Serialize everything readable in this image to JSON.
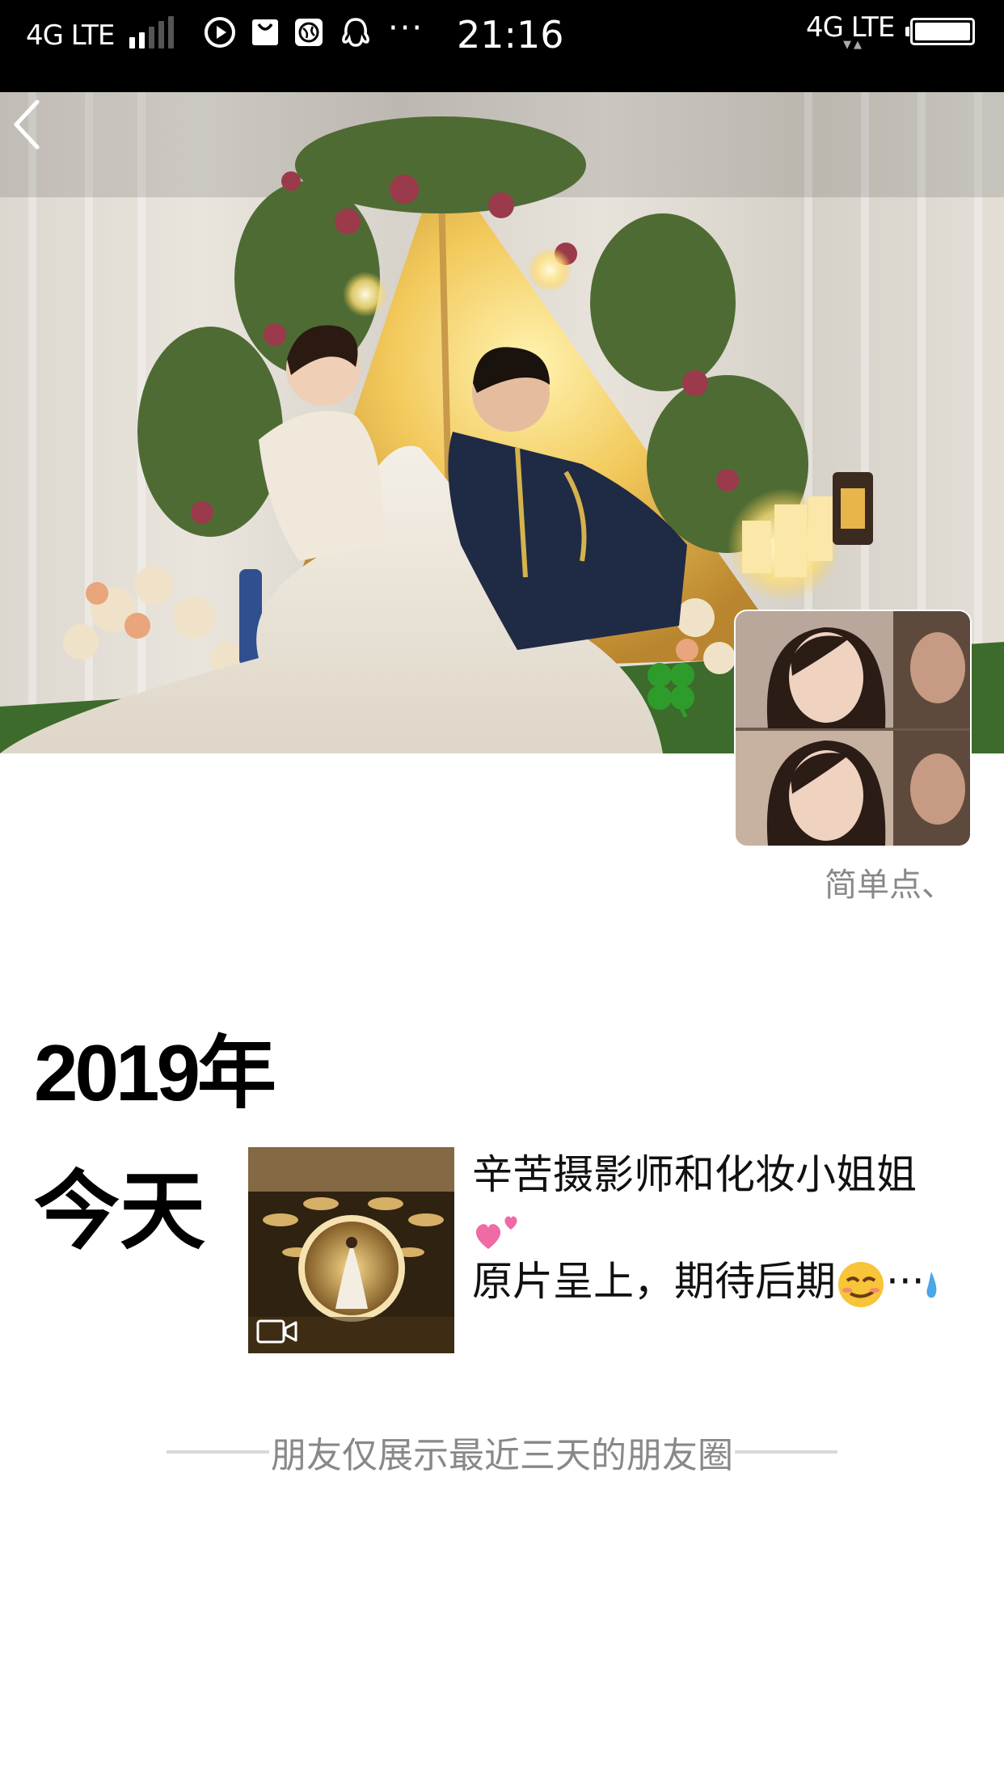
{
  "status_bar": {
    "carrier_left": "4G LTE",
    "more": "···",
    "time": "21:16",
    "carrier_right": "4G LTE",
    "signal_bars_active": 2,
    "battery_level": 1.0,
    "app_icons": [
      "video-play-icon",
      "shopping-bag-icon",
      "globe-icon",
      "qq-penguin-icon"
    ]
  },
  "header": {
    "back_icon": "chevron-left-icon",
    "cover_image": "wedding-photo"
  },
  "profile": {
    "signature": "简单点、"
  },
  "timeline": {
    "year": "2019年",
    "day": "今天",
    "post": {
      "thumbnail_type": "video",
      "line1": "辛苦摄影师和化妆小姐姐",
      "line3": "原片呈上，期待后期",
      "ellipsis": "···",
      "emojis": [
        "two-hearts-icon",
        "smirk-face-icon",
        "sweat-drop-icon"
      ]
    }
  },
  "footer": {
    "note": "朋友仅展示最近三天的朋友圈"
  },
  "colors": {
    "status_bar_bg": "#000000",
    "page_bg": "#ffffff",
    "secondary_text": "#888888",
    "divider": "#d9d9d9"
  }
}
